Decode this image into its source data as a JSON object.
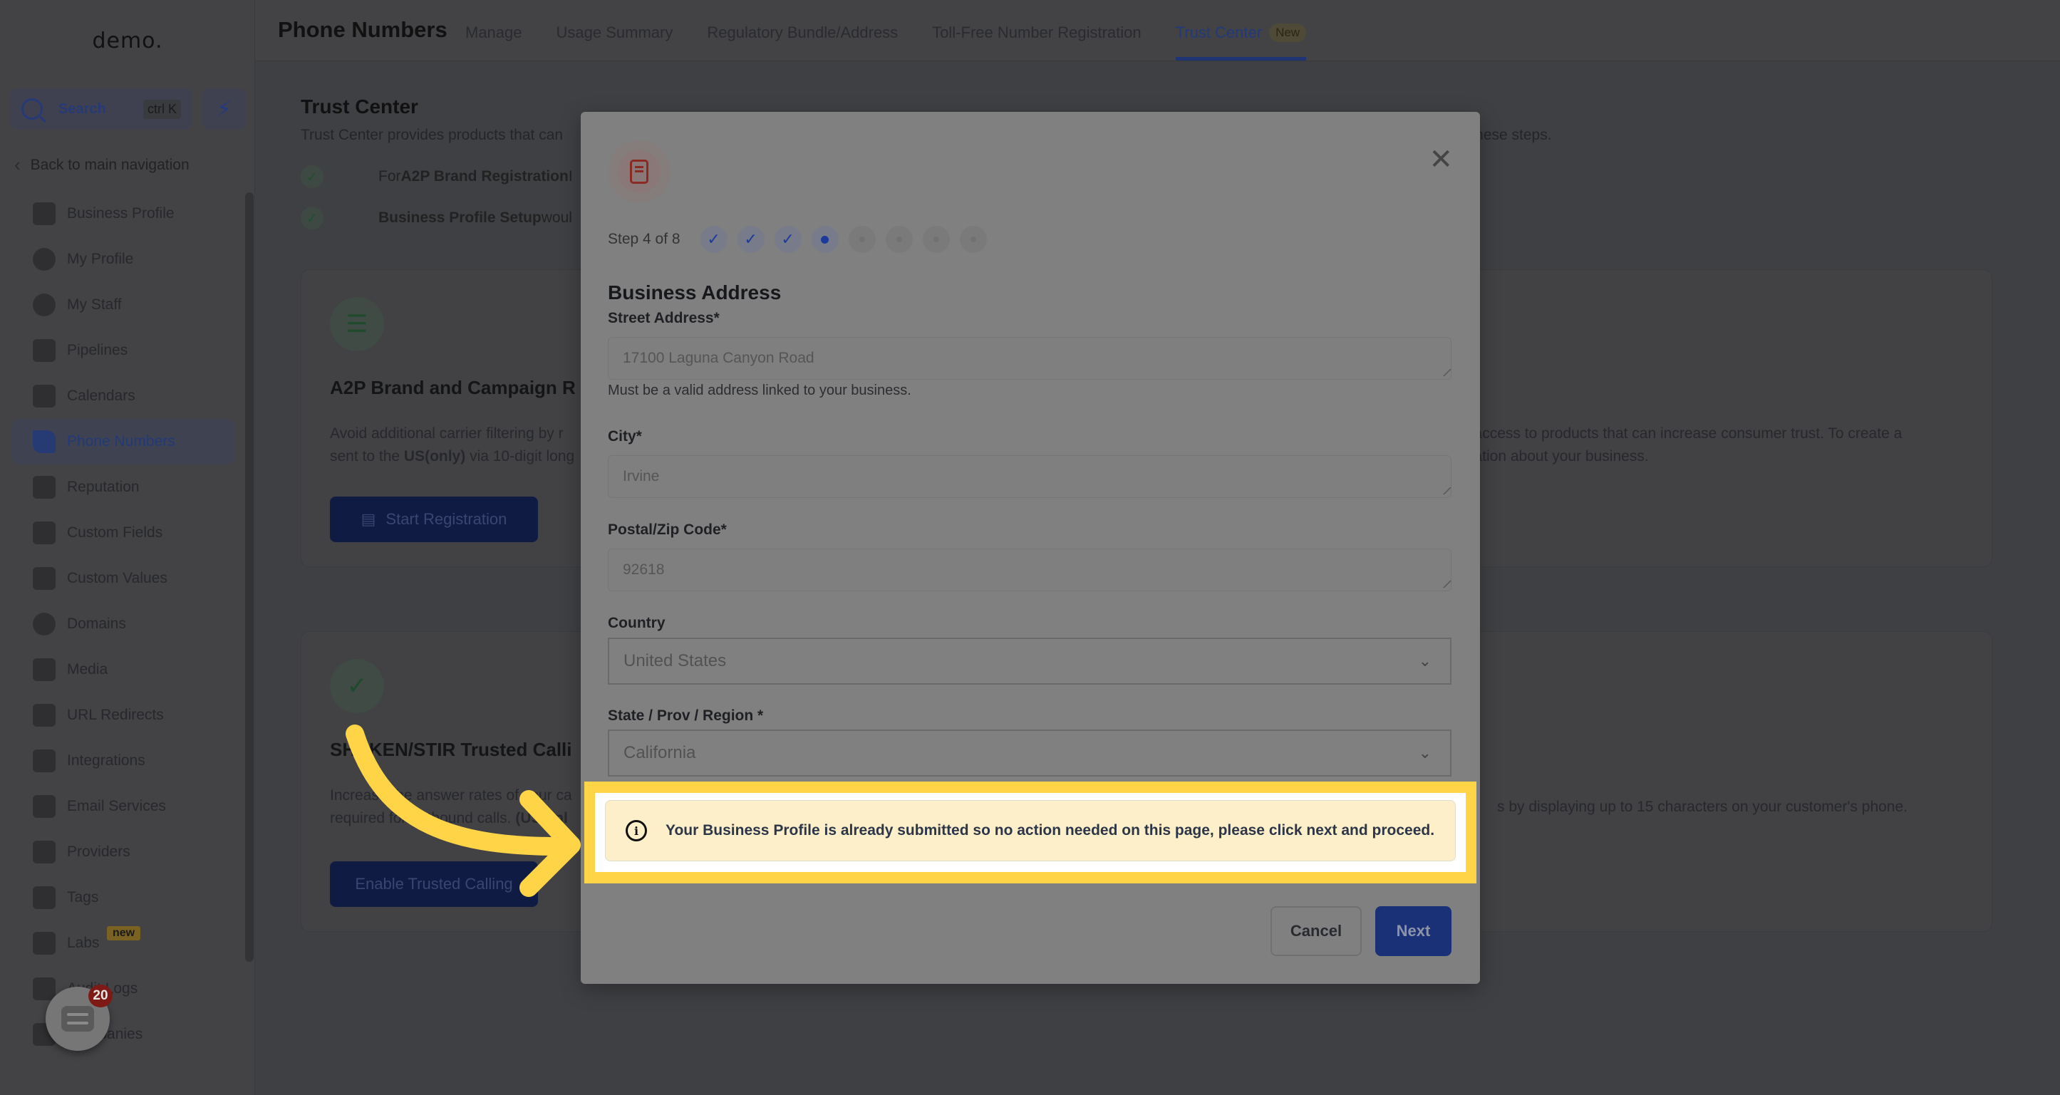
{
  "app": {
    "logo": "demo."
  },
  "sidebar": {
    "search_label": "Search",
    "search_shortcut": "ctrl K",
    "back_label": "Back to main navigation",
    "items": [
      {
        "label": "Business Profile",
        "icon": "briefcase-icon"
      },
      {
        "label": "My Profile",
        "icon": "user-circle-icon"
      },
      {
        "label": "My Staff",
        "icon": "user-icon"
      },
      {
        "label": "Pipelines",
        "icon": "funnel-icon"
      },
      {
        "label": "Calendars",
        "icon": "calendar-icon"
      },
      {
        "label": "Phone Numbers",
        "icon": "phone-icon",
        "active": true
      },
      {
        "label": "Reputation",
        "icon": "star-icon"
      },
      {
        "label": "Custom Fields",
        "icon": "custom-fields-icon"
      },
      {
        "label": "Custom Values",
        "icon": "diamond-icon"
      },
      {
        "label": "Domains",
        "icon": "globe-icon"
      },
      {
        "label": "Media",
        "icon": "video-icon"
      },
      {
        "label": "URL Redirects",
        "icon": "redirect-icon"
      },
      {
        "label": "Integrations",
        "icon": "integrations-icon"
      },
      {
        "label": "Email Services",
        "icon": "mail-icon"
      },
      {
        "label": "Providers",
        "icon": "clipboard-check-icon"
      },
      {
        "label": "Tags",
        "icon": "tag-icon"
      },
      {
        "label": "Labs",
        "icon": "flask-icon",
        "badge": "new"
      },
      {
        "label": "Audit Logs",
        "icon": "bar-chart-icon"
      },
      {
        "label": "Companies",
        "icon": "building-icon"
      }
    ],
    "chat_badge_count": "20"
  },
  "header": {
    "title": "Phone Numbers",
    "tabs": [
      {
        "label": "Manage"
      },
      {
        "label": "Usage Summary"
      },
      {
        "label": "Regulatory Bundle/Address"
      },
      {
        "label": "Toll-Free Number Registration"
      },
      {
        "label": "Trust Center",
        "badge": "New",
        "active": true
      }
    ]
  },
  "trust_center": {
    "title": "Trust Center",
    "description_visible_left": "Trust Center provides products that can",
    "description_visible_right": "v these steps.",
    "checklist": [
      {
        "prefix": "For ",
        "bold": "A2P Brand Registration",
        "suffix": " I"
      },
      {
        "prefix": "",
        "bold": "Business Profile Setup",
        "suffix": " woul"
      }
    ],
    "cards": [
      {
        "title": "A2P Brand and Campaign R",
        "text_line1": "Avoid additional carrier filtering by r",
        "text_line2_prefix": "sent to the ",
        "text_line2_bold": "US(only)",
        "text_line2_suffix": " via 10-digit long",
        "text_right_line1": "u access to products that can increase consumer trust. To create a",
        "text_right_line2": "mation about your business.",
        "button": "Start Registration"
      },
      {
        "title": "SHAKEN/STIR Trusted Calli",
        "text_line1": "Increase the answer rates of your ca",
        "text_line2_prefix": "required for outbound calls. ",
        "text_line2_bold": "(US onl",
        "text_right_line1": "s by displaying up to 15 characters on your customer's phone.",
        "button": "Enable Trusted Calling"
      }
    ]
  },
  "modal": {
    "step_label": "Step 4 of 8",
    "steps": {
      "total": 8,
      "current": 4,
      "completed": 3
    },
    "section_title": "Business Address",
    "fields": {
      "street": {
        "label": "Street Address*",
        "value": "17100 Laguna Canyon Road",
        "help": "Must be a valid address linked to your business."
      },
      "city": {
        "label": "City*",
        "value": "Irvine"
      },
      "postal": {
        "label": "Postal/Zip Code*",
        "value": "92618"
      },
      "country": {
        "label": "Country",
        "value": "United States"
      },
      "state": {
        "label": "State / Prov / Region *",
        "value": "California"
      }
    },
    "alert": "Your Business Profile is already submitted so no action needed on this page, please click next and proceed.",
    "cancel_label": "Cancel",
    "next_label": "Next"
  },
  "colors": {
    "highlight": "#ffd447",
    "primary": "#1a3178",
    "alert_bg": "#fcefc9"
  }
}
